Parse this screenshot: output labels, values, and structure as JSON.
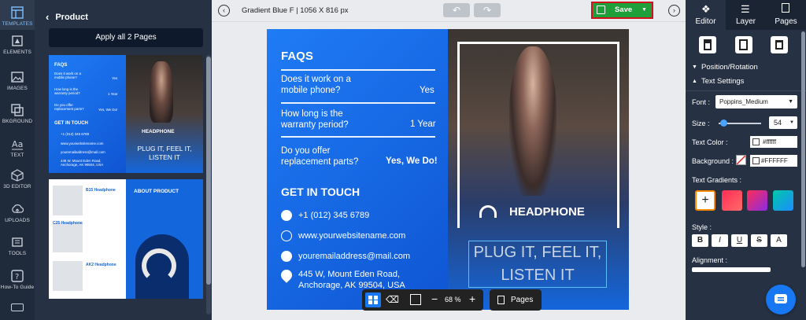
{
  "rail": {
    "items": [
      {
        "label": "TEMPLATES",
        "icon": "templates-icon"
      },
      {
        "label": "ELEMENTS",
        "icon": "elements-icon"
      },
      {
        "label": "IMAGES",
        "icon": "images-icon"
      },
      {
        "label": "BKGROUND",
        "icon": "background-icon"
      },
      {
        "label": "TEXT",
        "icon": "text-icon"
      },
      {
        "label": "3D EDITOR",
        "icon": "cube-icon"
      },
      {
        "label": "UPLOADS",
        "icon": "upload-icon"
      },
      {
        "label": "TOOLS",
        "icon": "tools-icon"
      },
      {
        "label": "How-To Guide",
        "icon": "question-icon"
      }
    ]
  },
  "panel": {
    "title": "Product",
    "apply_label": "Apply all 2 Pages",
    "thumb1": {
      "faqs": "FAQS",
      "q1": "Does it work on a mobile phone?",
      "a1": "Yes",
      "q2": "How long is the warranty period?",
      "a2": "1 Year",
      "q3": "Do you offer replacement parts?",
      "a3": "Yes, We Do!",
      "touch": "GET IN TOUCH",
      "phone": "+1 (012) 345 6789",
      "web": "www.yourwebsitename.com",
      "email": "youremailaddress@mail.com",
      "addr": "445 W. Mount Eden Road, Anchorage, AK 99504, USA",
      "brand": "HEADPHONE",
      "tagline": "PLUG IT, FEEL IT, LISTEN IT"
    },
    "thumb2": {
      "p1": "B15 Headphone",
      "p2": "C25 Headphone",
      "p3": "AK2 Headphone",
      "about": "ABOUT PRODUCT"
    }
  },
  "topbar": {
    "doc_title": "Gradient Blue F | 1056 X 816 px",
    "save_label": "Save"
  },
  "canvas": {
    "faqs": "FAQS",
    "q1": "Does it work on a mobile phone?",
    "a1": "Yes",
    "q2": "How long is the warranty period?",
    "a2": "1 Year",
    "q3": "Do you offer replacement parts?",
    "a3": "Yes, We Do!",
    "touch": "GET IN TOUCH",
    "phone": "+1 (012) 345 6789",
    "web": "www.yourwebsitename.com",
    "email": "youremailaddress@mail.com",
    "addr1": "445 W, Mount Eden Road,",
    "addr2": "Anchorage, AK 99504, USA",
    "brand": "HEADPHONE",
    "tag1": "PLUG IT, FEEL IT,",
    "tag2": "LISTEN IT"
  },
  "bottombar": {
    "zoom": "68 %",
    "pages_label": "Pages"
  },
  "rpanel": {
    "tabs": [
      "Editor",
      "Layer",
      "Pages"
    ],
    "position_rotation": "Position/Rotation",
    "text_settings": "Text Settings",
    "font_label": "Font :",
    "font_value": "Poppins_Medium",
    "size_label": "Size :",
    "size_value": "54",
    "text_color_label": "Text Color :",
    "text_color_value": "#ffffff",
    "background_label": "Background :",
    "background_value": "#FFFFFF",
    "gradients_label": "Text Gradients :",
    "style_label": "Style :",
    "alignment_label": "Alignment :",
    "style_buttons": [
      "B",
      "I",
      "U",
      "S",
      "A"
    ],
    "size_slider_fraction": 0.12
  },
  "colors": {
    "accent": "#1877f2",
    "save": "#1f9f39",
    "panel": "#263244",
    "rail": "#1f2a3a",
    "page_blue": "#1466dc"
  }
}
